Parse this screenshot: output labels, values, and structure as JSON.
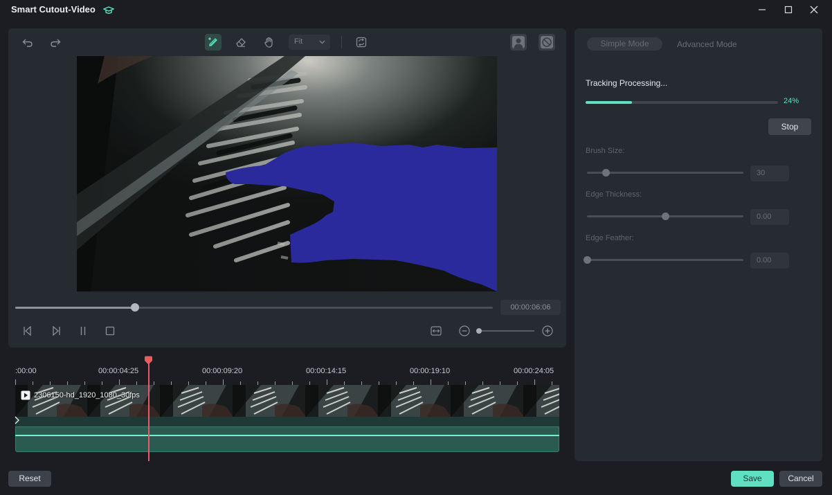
{
  "window": {
    "title": "Smart Cutout-Video",
    "badge_icon": "graduation-cap-icon",
    "controls": [
      "minimize-icon",
      "maximize-icon",
      "close-icon"
    ]
  },
  "toolbar": {
    "left_tools": [
      "undo-icon",
      "redo-icon"
    ],
    "center_tools": [
      "smart-brush-icon",
      "eraser-icon",
      "hand-icon"
    ],
    "active_tool": "smart-brush-icon",
    "fit_value": "Fit",
    "extra_tool": "refresh-icon",
    "right_tools": [
      "person-view-icon",
      "transparency-off-icon"
    ]
  },
  "player": {
    "time": "00:00:06:06",
    "scrub_progress": 0.25,
    "controls": [
      "prev-frame-icon",
      "next-frame-icon",
      "pause-icon",
      "stop-icon"
    ],
    "zoom_controls": [
      "fit-timeline-icon",
      "zoom-out-icon",
      "zoom-in-icon"
    ],
    "zoom_level": 0.02
  },
  "timeline": {
    "ticks": [
      ":00:00",
      "00:00:04:25",
      "00:00:09:20",
      "00:00:14:15",
      "00:00:19:10",
      "00:00:24:05"
    ],
    "clip_name": "2306150-hd_1920_1080_30fps"
  },
  "modes": {
    "simple": "Simple Mode",
    "advanced": "Advanced Mode",
    "active": "simple"
  },
  "tracking": {
    "label": "Tracking Processing...",
    "percent": 24,
    "percent_text": "24%",
    "stop_label": "Stop"
  },
  "params": {
    "brush": {
      "label": "Brush Size:",
      "value": "30",
      "fraction": 0.12
    },
    "thickness": {
      "label": "Edge Thickness:",
      "value": "0.00",
      "fraction": 0.5
    },
    "feather": {
      "label": "Edge Feather:",
      "value": "0.00",
      "fraction": 0.0
    }
  },
  "footer": {
    "reset_label": "Reset",
    "save_label": "Save",
    "cancel_label": "Cancel"
  },
  "colors": {
    "accent": "#5fe0c3",
    "playhead": "#e85d5d",
    "mask": "#2a2a9c"
  }
}
